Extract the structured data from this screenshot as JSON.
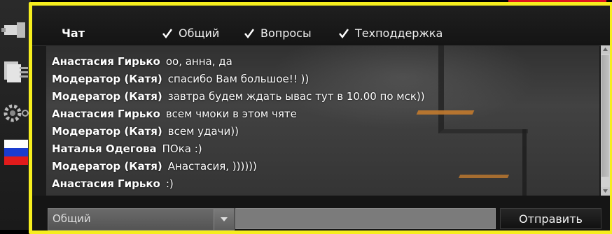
{
  "chat": {
    "title": "Чат",
    "filters": [
      {
        "label": "Общий",
        "checked": true
      },
      {
        "label": "Вопросы",
        "checked": true
      },
      {
        "label": "Техподдержка",
        "checked": true
      }
    ],
    "messages": [
      {
        "author": "Анастасия Гирько",
        "text": "оо, анна, да"
      },
      {
        "author": "Модератор (Катя)",
        "text": "спасибо Вам большое!! ))"
      },
      {
        "author": "Модератор (Катя)",
        "text": "завтра будем ждать ывас тут в 10.00 по мск))"
      },
      {
        "author": "Анастасия Гирько",
        "text": "всем чмоки в этом чяте"
      },
      {
        "author": "Модератор (Катя)",
        "text": "всем удачи))"
      },
      {
        "author": "Наталья Одегова",
        "text": "ПОка :)"
      },
      {
        "author": "Модератор (Катя)",
        "text": "Анастасия, ))))))"
      },
      {
        "author": "Анастасия Гирько",
        "text": ":)"
      }
    ],
    "channel_select": {
      "value": "Общий"
    },
    "message_input": {
      "value": ""
    },
    "send_label": "Отправить"
  },
  "sidebar": {
    "icons": [
      "camera-icon",
      "document-stack-icon",
      "gear-icon",
      "russia-flag-icon"
    ]
  },
  "colors": {
    "highlight_frame": "#f6ee1e",
    "accent_red": "#e0161e",
    "text": "#ffffff"
  }
}
